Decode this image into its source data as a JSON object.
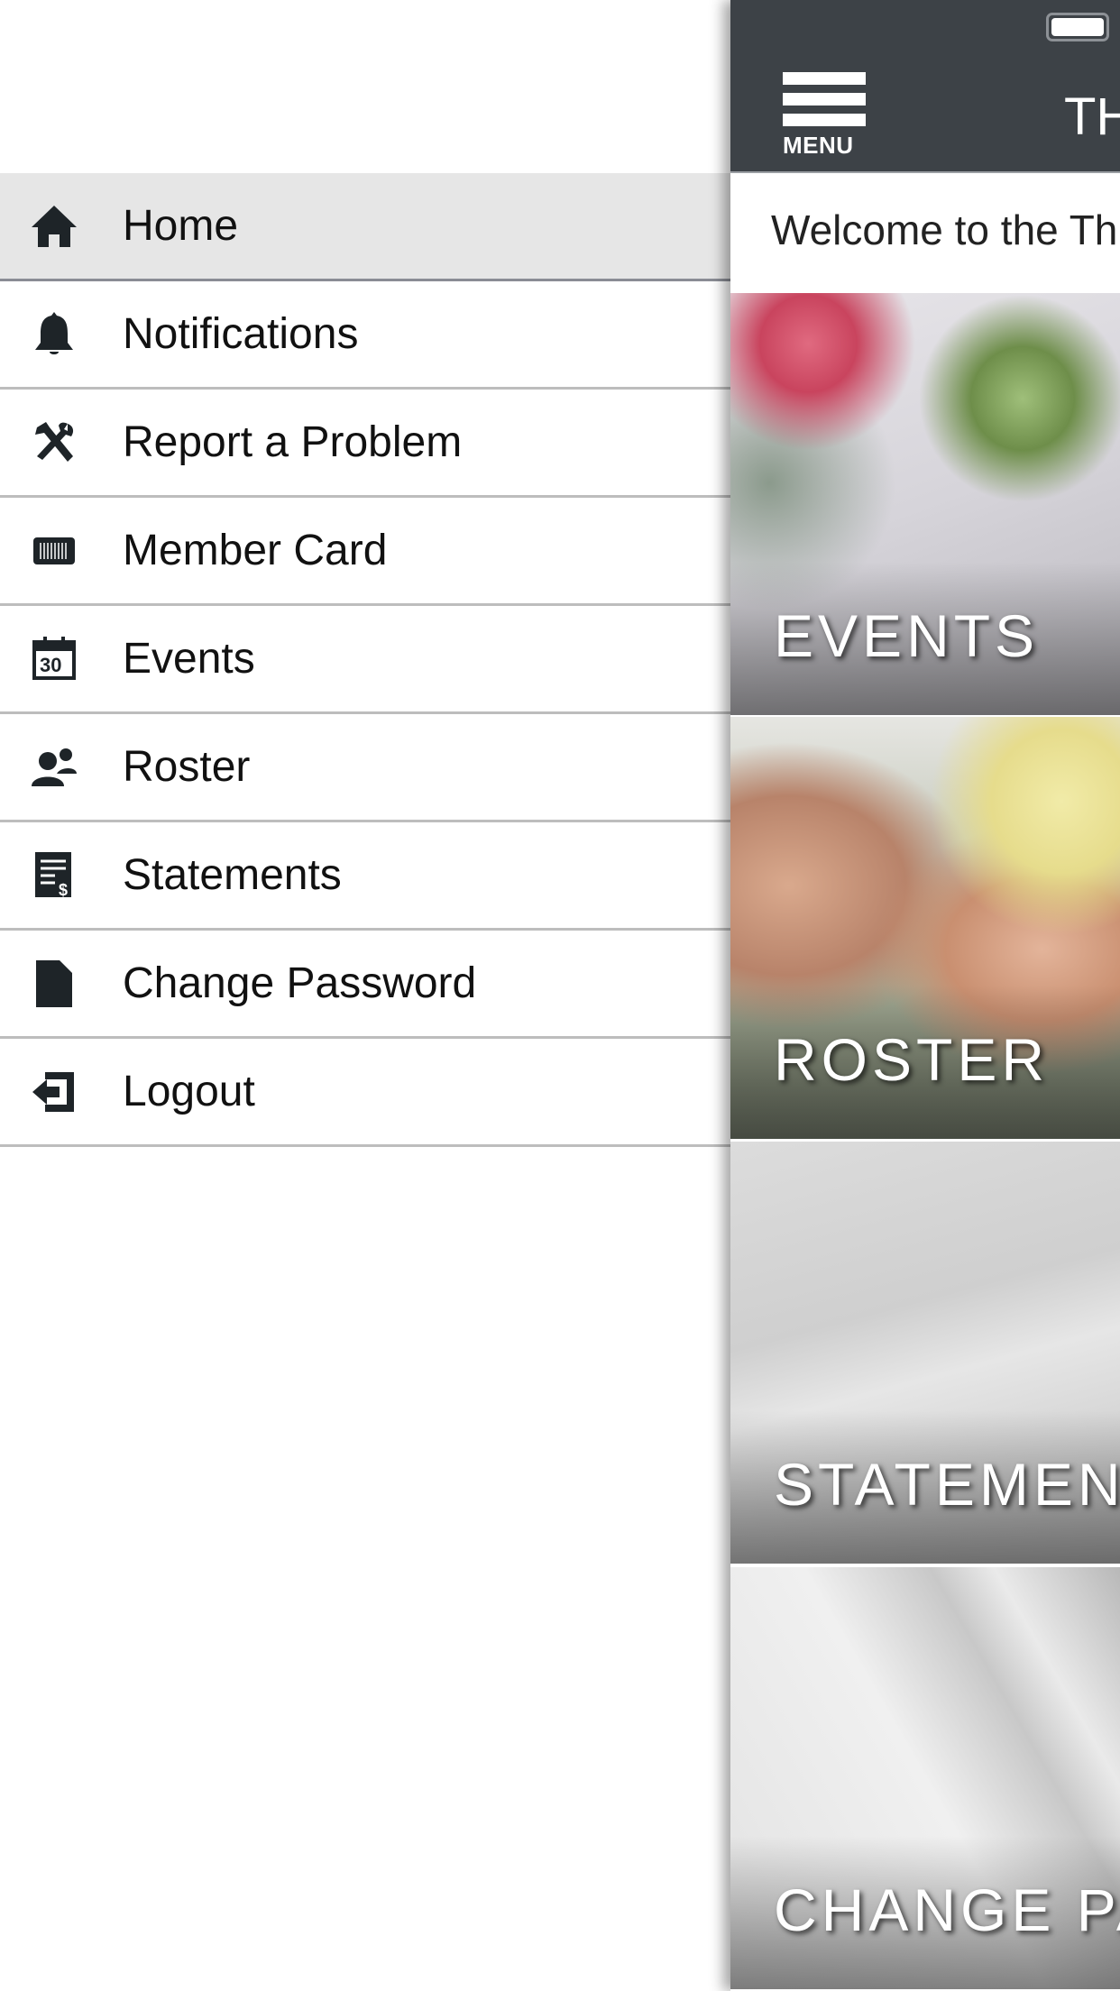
{
  "nav": {
    "items": [
      {
        "label": "Home",
        "icon": "home-icon",
        "active": true
      },
      {
        "label": "Notifications",
        "icon": "bell-icon"
      },
      {
        "label": "Report a Problem",
        "icon": "tools-icon"
      },
      {
        "label": "Member Card",
        "icon": "barcode-icon"
      },
      {
        "label": "Events",
        "icon": "calendar-icon",
        "calendar_day": "30"
      },
      {
        "label": "Roster",
        "icon": "user-group-icon"
      },
      {
        "label": "Statements",
        "icon": "statement-icon"
      },
      {
        "label": "Change Password",
        "icon": "document-icon"
      },
      {
        "label": "Logout",
        "icon": "logout-icon"
      }
    ]
  },
  "header": {
    "menu_label": "MENU",
    "title": "TH"
  },
  "welcome": "Welcome to the Th",
  "tiles": [
    {
      "label": "EVENTS"
    },
    {
      "label": "ROSTER"
    },
    {
      "label": "STATEMEN"
    },
    {
      "label": "CHANGE PA"
    }
  ],
  "colors": {
    "header": "#3d4247",
    "active_row": "#e6e6e6",
    "icon": "#1e2428"
  }
}
